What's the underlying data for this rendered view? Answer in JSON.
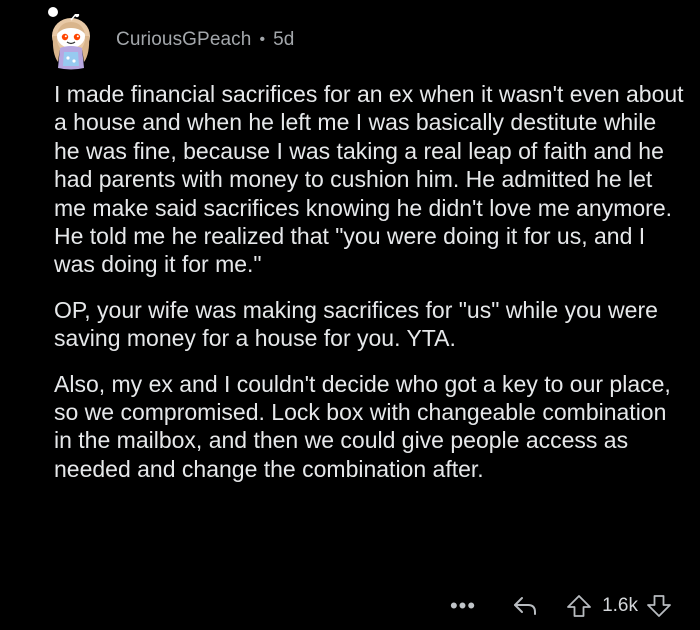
{
  "comment": {
    "author": "CuriousGPeach",
    "separator": "•",
    "age": "5d",
    "paragraphs": [
      "I made financial sacrifices for an ex when it wasn't even about a house and when he left me I was basically destitute while he was fine, because I was taking a real leap of faith and he had parents with money to cushion him. He admitted he let me make said sacrifices knowing he didn't love me anymore. He told me he realized that \"you were doing it for us, and I was doing it for me.\"",
      "OP, your wife was making sacrifices for \"us\" while you were saving money for a house for you. YTA.",
      "Also, my ex and I couldn't decide who got a key to our place, so we compromised. Lock box with changeable combination in the mailbox, and then we could give people access as needed and change the combination after."
    ]
  },
  "actions": {
    "more": "•••",
    "score": "1.6k"
  },
  "icons": {
    "avatar": "snoo-avatar-icon",
    "reply": "reply-arrow-icon",
    "upvote": "upvote-arrow-icon",
    "downvote": "downvote-arrow-icon",
    "more": "more-options-icon"
  },
  "colors": {
    "background": "#000000",
    "body_text": "#e6e8ea",
    "meta_text": "#a3a7ab"
  }
}
